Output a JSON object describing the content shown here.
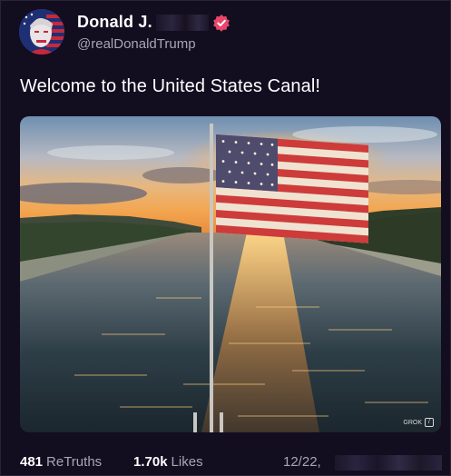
{
  "post": {
    "display_name": "Donald J.",
    "handle": "@realDonaldTrump",
    "text": "Welcome to the United States Canal!",
    "media_watermark": "GROK"
  },
  "stats": {
    "retruths_count": "481",
    "retruths_label": "ReTruths",
    "likes_count": "1.70k",
    "likes_label": "Likes",
    "date_partial": "12/22,"
  },
  "icons": {
    "verified": "verified-badge-icon",
    "watermark": "grok-logo-icon"
  },
  "colors": {
    "background": "#120d1f",
    "verified": "#e8476b",
    "muted_text": "#a9a5b7"
  }
}
